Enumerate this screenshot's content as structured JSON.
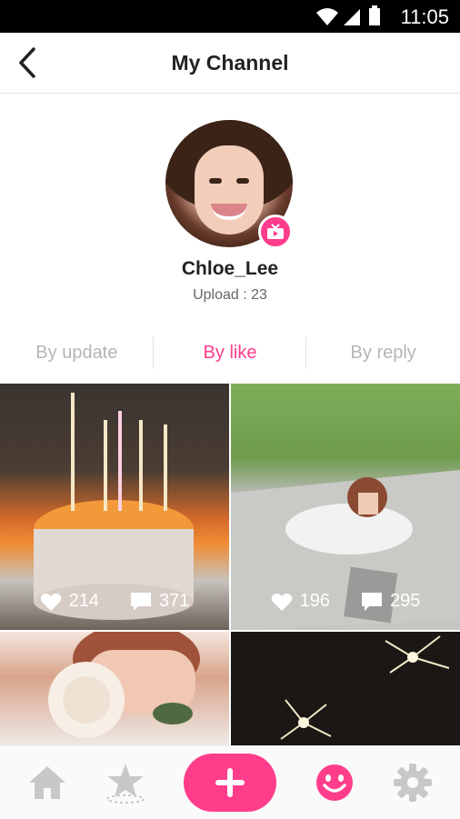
{
  "status_bar": {
    "time": "11:05",
    "icons": [
      "wifi-icon",
      "signal-icon",
      "battery-icon"
    ]
  },
  "header": {
    "title": "My Channel",
    "back_icon": "chevron-left-icon"
  },
  "profile": {
    "username": "Chloe_Lee",
    "upload_text": "Upload : 23",
    "badge_icon": "tv-icon"
  },
  "tabs": [
    {
      "label": "By update",
      "active": false
    },
    {
      "label": "By like",
      "active": true
    },
    {
      "label": "By reply",
      "active": false
    }
  ],
  "posts": [
    {
      "likes": "214",
      "comments": "371"
    },
    {
      "likes": "196",
      "comments": "295"
    },
    {
      "likes": "",
      "comments": ""
    },
    {
      "likes": "",
      "comments": ""
    }
  ],
  "bottom_nav": [
    {
      "icon": "home-icon"
    },
    {
      "icon": "star-icon"
    },
    {
      "icon": "plus-icon"
    },
    {
      "icon": "smiley-icon"
    },
    {
      "icon": "gear-icon"
    }
  ],
  "colors": {
    "accent": "#ff3d8b",
    "inactive_tab": "#b5b5b5",
    "nav_icon": "#c8c8c8"
  }
}
